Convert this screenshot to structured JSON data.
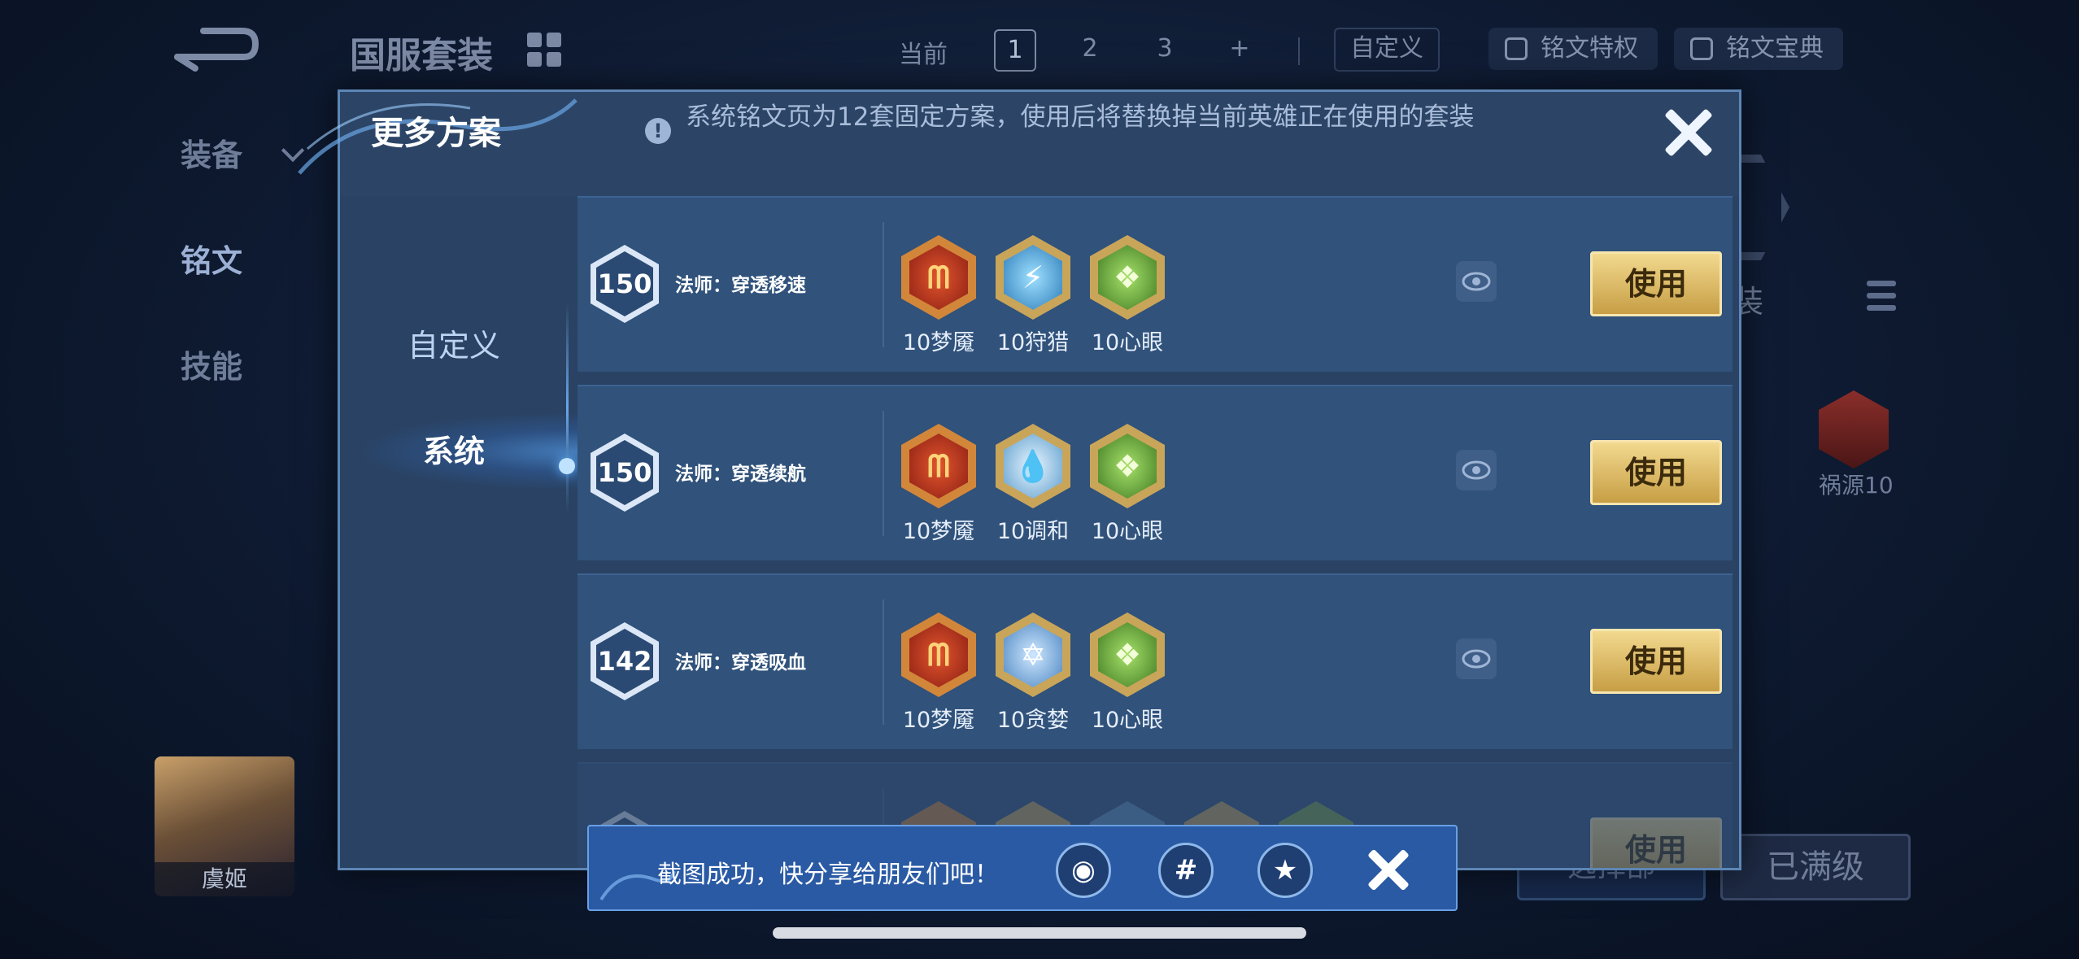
{
  "background": {
    "title": "国服套装",
    "current_label": "当前",
    "pages": [
      "1",
      "2",
      "3",
      "+"
    ],
    "custom_label": "自定义",
    "privilege_label": "铭文特权",
    "codex_label": "铭文宝典",
    "side_equip": "装备",
    "side_inscription": "铭文",
    "side_skill": "技能",
    "hero_name": "虞姬",
    "right_text": "装",
    "rune_right_label": "祸源10",
    "btn_left": "选择部",
    "btn_max": "已满级"
  },
  "modal": {
    "title": "更多方案",
    "notice": "系统铭文页为12套固定方案，使用后将替换掉当前英雄正在使用的套装",
    "nav": {
      "custom": "自定义",
      "system": "系统"
    },
    "use_label": "使用",
    "rows": [
      {
        "level": "150",
        "name": "法师：穿透移速",
        "runes": [
          {
            "label": "10梦魇",
            "kind": "red"
          },
          {
            "label": "10狩猎",
            "kind": "blue"
          },
          {
            "label": "10心眼",
            "kind": "green"
          }
        ]
      },
      {
        "level": "150",
        "name": "法师：穿透续航",
        "runes": [
          {
            "label": "10梦魇",
            "kind": "red"
          },
          {
            "label": "10调和",
            "kind": "blue"
          },
          {
            "label": "10心眼",
            "kind": "green"
          }
        ]
      },
      {
        "level": "142",
        "name": "法师：穿透吸血",
        "runes": [
          {
            "label": "10梦魇",
            "kind": "red"
          },
          {
            "label": "10贪婪",
            "kind": "blue"
          },
          {
            "label": "10心眼",
            "kind": "green"
          }
        ]
      }
    ]
  },
  "toast": {
    "text": "截图成功，快分享给朋友们吧！"
  },
  "colors": {
    "gold_button": "#d9b865",
    "modal_bg": "#2a4263",
    "row_bg": "#30527b",
    "toast_bg": "#2a5aa4"
  }
}
